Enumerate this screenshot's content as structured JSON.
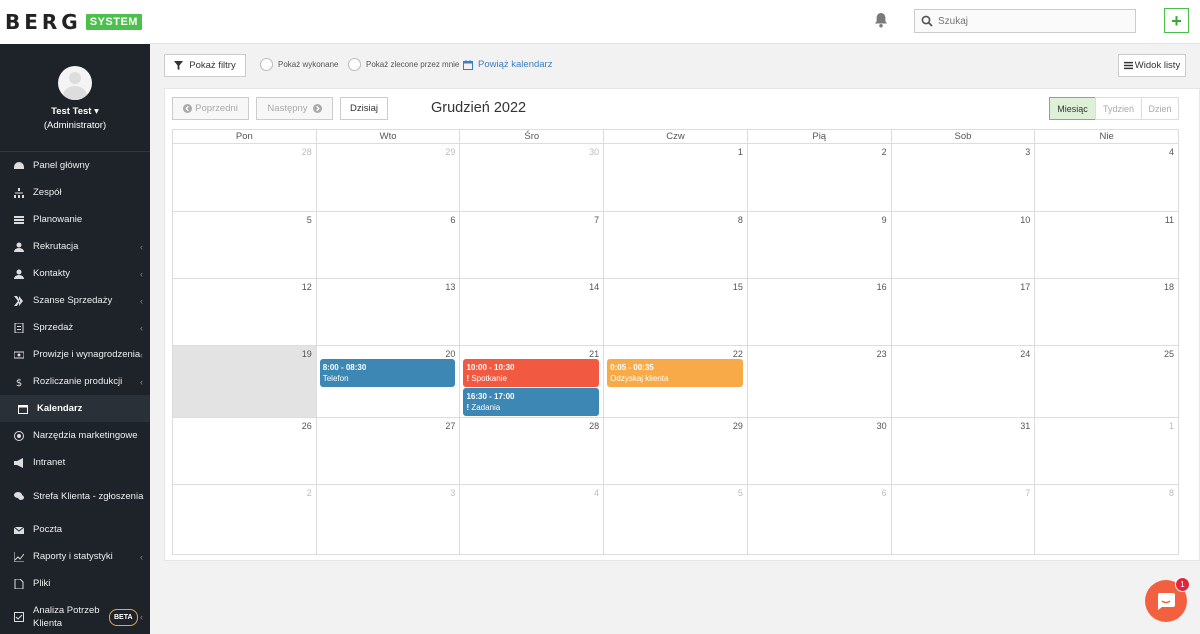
{
  "brand": {
    "name": "BERG",
    "badge": "SYSTEM"
  },
  "header": {
    "search_placeholder": "Szukaj",
    "add_label": "+"
  },
  "user": {
    "name": "Test Test",
    "caret": "▾",
    "role": "(Administrator)"
  },
  "sidebar": {
    "items": [
      {
        "label": "Panel główny",
        "icon": "dashboard-icon",
        "chevron": false
      },
      {
        "label": "Zespół",
        "icon": "sitemap-icon",
        "chevron": false
      },
      {
        "label": "Planowanie",
        "icon": "list-icon",
        "chevron": false
      },
      {
        "label": "Rekrutacja",
        "icon": "user-icon",
        "chevron": true
      },
      {
        "label": "Kontakty",
        "icon": "user-icon",
        "chevron": true
      },
      {
        "label": "Szanse Sprzedaży",
        "icon": "funnel-icon",
        "chevron": true
      },
      {
        "label": "Sprzedaż",
        "icon": "document-icon",
        "chevron": true
      },
      {
        "label": "Prowizje i wynagrodzenia",
        "icon": "money-icon",
        "chevron": true
      },
      {
        "label": "Rozliczanie produkcji",
        "icon": "dollar-icon",
        "chevron": true
      },
      {
        "label": "Kalendarz",
        "icon": "calendar-icon",
        "chevron": false,
        "active": true
      },
      {
        "label": "Narzędzia marketingowe",
        "icon": "target-icon",
        "chevron": false
      },
      {
        "label": "Intranet",
        "icon": "megaphone-icon",
        "chevron": false
      },
      {
        "label": "Strefa Klienta - zgłoszenia",
        "icon": "comments-icon",
        "chevron": false,
        "tall": true
      },
      {
        "label": "Poczta",
        "icon": "envelope-icon",
        "chevron": false
      },
      {
        "label": "Raporty i statystyki",
        "icon": "chart-icon",
        "chevron": true
      },
      {
        "label": "Pliki",
        "icon": "file-icon",
        "chevron": false
      },
      {
        "label": "Analiza Potrzeb Klienta",
        "icon": "checkbox-icon",
        "chevron": true,
        "beta": "BETA",
        "tall": true
      }
    ]
  },
  "toolbar": {
    "show_filters": "Pokaż filtry",
    "show_done": "Pokaż wykonane",
    "show_ordered": "Pokaż zlecone przez mnie",
    "link_calendar": "Powiąż kalendarz",
    "list_view": "Widok listy"
  },
  "calendar": {
    "prev": "Poprzedni",
    "next": "Następny",
    "today": "Dzisiaj",
    "title": "Grudzień 2022",
    "views": {
      "month": "Miesiąc",
      "week": "Tydzień",
      "day": "Dzień"
    },
    "days": [
      "Pon",
      "Wto",
      "Śro",
      "Czw",
      "Pią",
      "Sob",
      "Nie"
    ],
    "weeks": [
      [
        {
          "d": "28",
          "o": true
        },
        {
          "d": "29",
          "o": true
        },
        {
          "d": "30",
          "o": true
        },
        {
          "d": "1"
        },
        {
          "d": "2"
        },
        {
          "d": "3"
        },
        {
          "d": "4"
        }
      ],
      [
        {
          "d": "5"
        },
        {
          "d": "6"
        },
        {
          "d": "7"
        },
        {
          "d": "8"
        },
        {
          "d": "9"
        },
        {
          "d": "10"
        },
        {
          "d": "11"
        }
      ],
      [
        {
          "d": "12"
        },
        {
          "d": "13"
        },
        {
          "d": "14"
        },
        {
          "d": "15"
        },
        {
          "d": "16"
        },
        {
          "d": "17"
        },
        {
          "d": "18"
        }
      ],
      [
        {
          "d": "19",
          "today": true
        },
        {
          "d": "20"
        },
        {
          "d": "21"
        },
        {
          "d": "22"
        },
        {
          "d": "23"
        },
        {
          "d": "24"
        },
        {
          "d": "25"
        }
      ],
      [
        {
          "d": "26"
        },
        {
          "d": "27"
        },
        {
          "d": "28"
        },
        {
          "d": "29"
        },
        {
          "d": "30"
        },
        {
          "d": "31"
        },
        {
          "d": "1",
          "o": true
        }
      ],
      [
        {
          "d": "2",
          "o": true
        },
        {
          "d": "3",
          "o": true
        },
        {
          "d": "4",
          "o": true
        },
        {
          "d": "5",
          "o": true
        },
        {
          "d": "6",
          "o": true
        },
        {
          "d": "7",
          "o": true
        },
        {
          "d": "8",
          "o": true
        }
      ]
    ],
    "events": [
      {
        "week": 3,
        "day": 1,
        "slot": 0,
        "time": "8:00 - 08:30",
        "title": "Telefon",
        "color": "blue",
        "flag": ""
      },
      {
        "week": 3,
        "day": 2,
        "slot": 0,
        "time": "10:00 - 10:30",
        "title": "Spotkanie",
        "color": "red",
        "flag": "!"
      },
      {
        "week": 3,
        "day": 2,
        "slot": 1,
        "time": "16:30 - 17:00",
        "title": "Zadania",
        "color": "blue",
        "flag": "!"
      },
      {
        "week": 3,
        "day": 3,
        "slot": 0,
        "time": "0:05 - 00:35",
        "title": "Odzyskaj klienta",
        "color": "orange",
        "flag": ""
      }
    ]
  },
  "chat": {
    "badge": "1"
  }
}
